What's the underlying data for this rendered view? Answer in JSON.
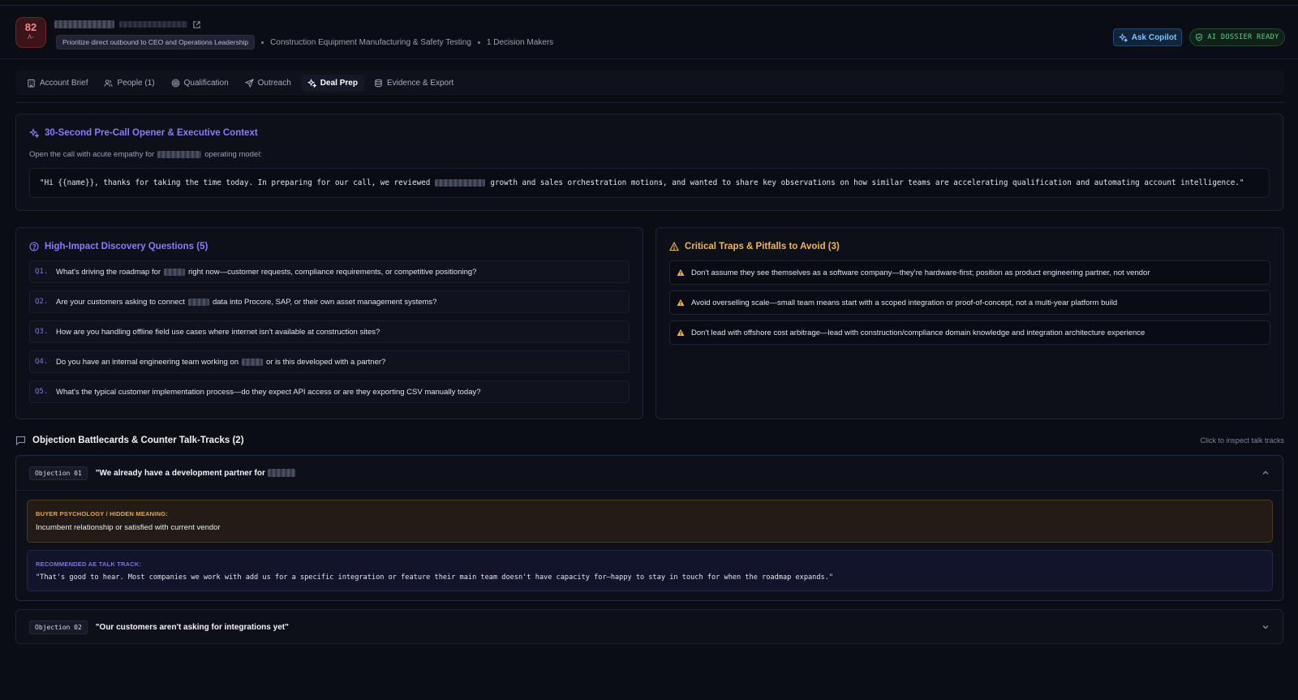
{
  "header": {
    "score": "82",
    "grade": "A-",
    "priority": "Prioritize direct outbound to CEO and Operations Leadership",
    "industry": "Construction Equipment Manufacturing & Safety Testing",
    "decision_makers": "1 Decision Makers",
    "ask_copilot": "Ask Copilot",
    "dossier_status": "AI DOSSIER READY"
  },
  "tabs": [
    {
      "label": "Account Brief",
      "icon": "building-icon"
    },
    {
      "label": "People (1)",
      "icon": "people-icon"
    },
    {
      "label": "Qualification",
      "icon": "target-icon"
    },
    {
      "label": "Outreach",
      "icon": "send-icon"
    },
    {
      "label": "Deal Prep",
      "icon": "sparkle-icon",
      "active": true
    },
    {
      "label": "Evidence & Export",
      "icon": "database-icon"
    }
  ],
  "opener": {
    "title": "30-Second Pre-Call Opener & Executive Context",
    "lead_prefix": "Open the call with acute empathy for",
    "lead_suffix": "operating model:",
    "quote_prefix": "\"Hi {{name}}, thanks for taking the time today. In preparing for our call, we reviewed",
    "quote_suffix": "growth and sales orchestration motions, and wanted to share key observations on how similar teams are accelerating qualification and automating account intelligence.\""
  },
  "questions": {
    "title": "High-Impact Discovery Questions (5)",
    "items": [
      {
        "num": "Q1.",
        "pre": "What's driving the roadmap for",
        "post": "right now—customer requests, compliance requirements, or competitive positioning?"
      },
      {
        "num": "Q2.",
        "pre": "Are your customers asking to connect",
        "post": "data into Procore, SAP, or their own asset management systems?"
      },
      {
        "num": "Q3.",
        "pre": "How are you handling offline field use cases where internet isn't available at construction sites?",
        "post": ""
      },
      {
        "num": "Q4.",
        "pre": "Do you have an internal engineering team working on",
        "post": "or is this developed with a partner?"
      },
      {
        "num": "Q5.",
        "pre": "What's the typical customer implementation process—do they expect API access or are they exporting CSV manually today?",
        "post": ""
      }
    ]
  },
  "traps": {
    "title": "Critical Traps & Pitfalls to Avoid (3)",
    "items": [
      "Don't assume they see themselves as a software company—they're hardware-first; position as product engineering partner, not vendor",
      "Avoid overselling scale—small team means start with a scoped integration or proof-of-concept, not a multi-year platform build",
      "Don't lead with offshore cost arbitrage—lead with construction/compliance domain knowledge and integration architecture experience"
    ]
  },
  "objections": {
    "title": "Objection Battlecards & Counter Talk-Tracks (2)",
    "hint": "Click to inspect talk tracks",
    "items": [
      {
        "tag": "Objection 01",
        "text": "\"We already have a development partner for",
        "psych_label": "BUYER PSYCHOLOGY / HIDDEN MEANING:",
        "psych": "Incumbent relationship or satisfied with current vendor",
        "talk_label": "RECOMMENDED AE TALK TRACK:",
        "talk": "\"That's good to hear. Most companies we work with add us for a specific integration or feature their main team doesn't have capacity for—happy to stay in touch for when the roadmap expands.\""
      },
      {
        "tag": "Objection 02",
        "text": "\"Our customers aren't asking for integrations yet\""
      }
    ]
  },
  "colors": {
    "accent_purple": "#8a7bff",
    "warning_amber": "#f0b64b",
    "copilot_blue": "#7fc3ff",
    "ready_green": "#4fd38a",
    "score_red": "#f08a8a"
  }
}
